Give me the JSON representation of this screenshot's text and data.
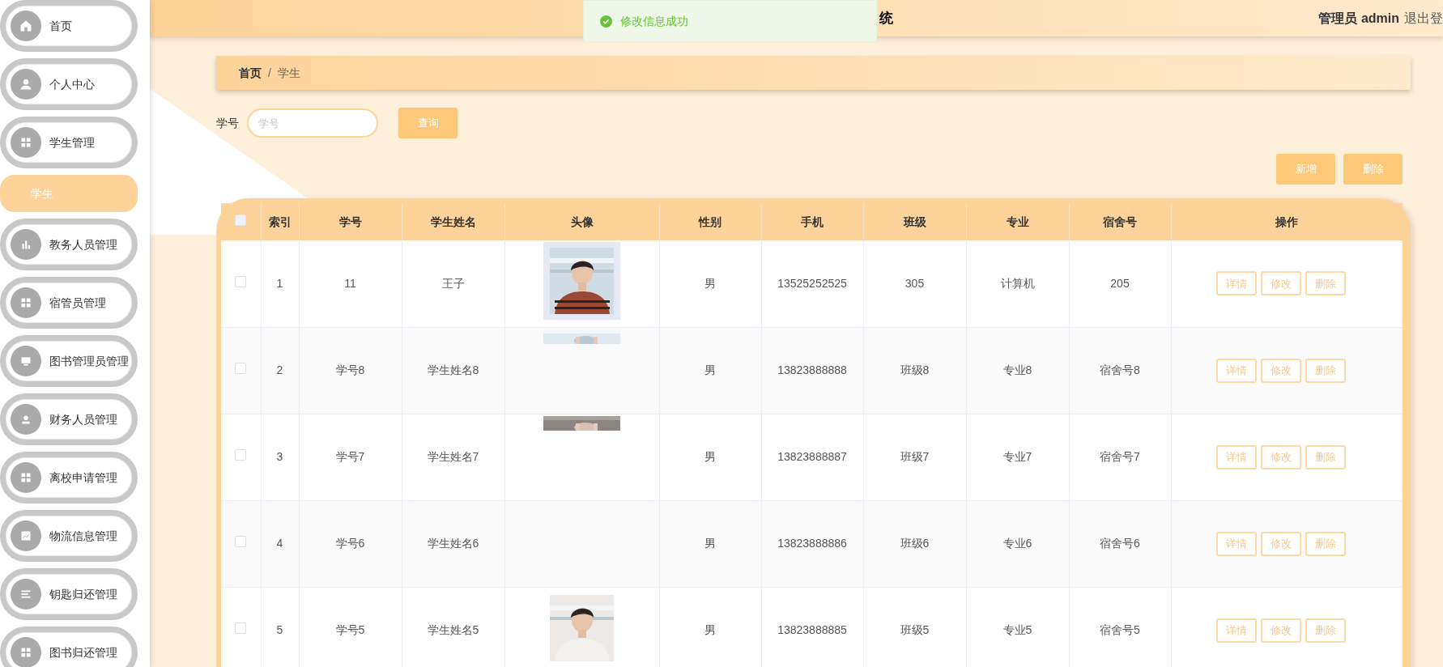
{
  "sidebar": {
    "items": [
      {
        "label": "首页",
        "selected": false
      },
      {
        "label": "个人中心",
        "selected": false
      },
      {
        "label": "学生管理",
        "selected": false,
        "children": [
          {
            "label": "学生",
            "selected": true
          }
        ]
      },
      {
        "label": "教务人员管理",
        "selected": false
      },
      {
        "label": "宿管员管理",
        "selected": false
      },
      {
        "label": "图书管理员管理",
        "selected": false
      },
      {
        "label": "财务人员管理",
        "selected": false
      },
      {
        "label": "离校申请管理",
        "selected": false
      },
      {
        "label": "物流信息管理",
        "selected": false
      },
      {
        "label": "钥匙归还管理",
        "selected": false
      },
      {
        "label": "图书归还管理",
        "selected": false
      }
    ]
  },
  "header": {
    "title": "统",
    "user": "管理员 admin",
    "logout": "退出登"
  },
  "toast": {
    "message": "修改信息成功"
  },
  "breadcrumb": [
    "首页",
    "学生"
  ],
  "breadcrumb_separator": "/",
  "search": {
    "label": "学号",
    "placeholder": "学号",
    "button": "查询"
  },
  "actions": [
    "新增",
    "删除"
  ],
  "table": {
    "header_checked": false,
    "columns": [
      "索引",
      "学号",
      "学生姓名",
      "头像",
      "性别",
      "手机",
      "班级",
      "专业",
      "宿舍号",
      "操作"
    ],
    "rows": [
      {
        "checked": false,
        "cells": [
          "1",
          "11",
          "王子"
        ],
        "photo": true,
        "photo_clipped": false,
        "tail": [
          "男",
          "13525252525",
          "305",
          "计算机",
          "205"
        ],
        "buttons": [
          "详情",
          "修改",
          "删除"
        ]
      },
      {
        "checked": false,
        "cells": [
          "2",
          "学号8",
          "学生姓名8"
        ],
        "photo": true,
        "photo_clipped": true,
        "tail": [
          "男",
          "13823888888",
          "班级8",
          "专业8",
          "宿舍号8"
        ],
        "buttons": [
          "详情",
          "修改",
          "删除"
        ]
      },
      {
        "checked": false,
        "cells": [
          "3",
          "学号7",
          "学生姓名7"
        ],
        "photo": true,
        "photo_clipped": true,
        "tail": [
          "男",
          "13823888887",
          "班级7",
          "专业7",
          "宿舍号7"
        ],
        "buttons": [
          "详情",
          "修改",
          "删除"
        ]
      },
      {
        "checked": false,
        "cells": [
          "4",
          "学号6",
          "学生姓名6"
        ],
        "photo": false,
        "tail": [
          "男",
          "13823888886",
          "班级6",
          "专业6",
          "宿舍号6"
        ],
        "buttons": [
          "详情",
          "修改",
          "删除"
        ]
      },
      {
        "checked": false,
        "cells": [
          "5",
          "学号5",
          "学生姓名5"
        ],
        "photo": true,
        "photo_clipped": false,
        "tail": [
          "男",
          "13823888885",
          "班级5",
          "专业5",
          "宿舍号5"
        ],
        "buttons": [
          "详情",
          "修改",
          "删除"
        ]
      }
    ]
  }
}
